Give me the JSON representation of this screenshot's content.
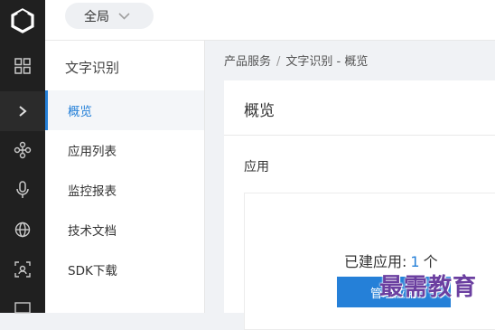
{
  "header": {
    "scope_select": "全局"
  },
  "rail": {
    "icons": [
      "logo-icon",
      "grid-icon",
      "chevron-right-icon",
      "cluster-icon",
      "microphone-icon",
      "globe-icon",
      "scan-face-icon",
      "monitor-icon"
    ]
  },
  "submenu": {
    "title": "文字识别",
    "items": [
      {
        "label": "概览",
        "active": true
      },
      {
        "label": "应用列表",
        "active": false
      },
      {
        "label": "监控报表",
        "active": false
      },
      {
        "label": "技术文档",
        "active": false
      },
      {
        "label": "SDK下载",
        "active": false
      }
    ]
  },
  "breadcrumb": {
    "items": [
      "产品服务",
      "文字识别 - 概览"
    ],
    "separator": "/"
  },
  "main": {
    "title": "概览",
    "section_title": "应用",
    "created_label": "已建应用:",
    "created_count": "1",
    "created_unit": "个",
    "manage_button": "管理应用"
  },
  "watermark": "最需教育",
  "colors": {
    "accent": "#2580d8",
    "rail_bg": "#202020"
  }
}
